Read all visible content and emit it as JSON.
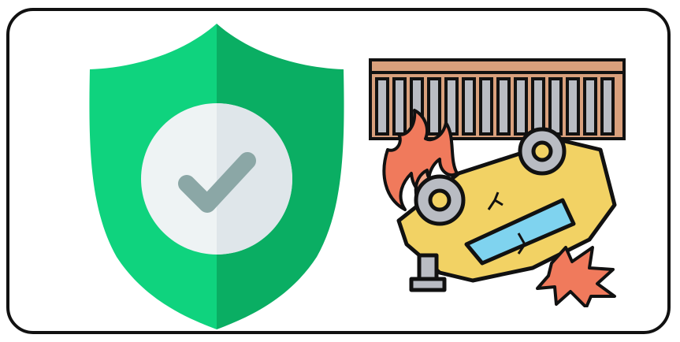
{
  "icons": [
    {
      "name": "shield-check-icon",
      "meaning": "protection",
      "colors": {
        "left": "#0fd37e",
        "right": "#0aae63",
        "circle": "#eef3f4",
        "check": "#8ba7a6"
      }
    },
    {
      "name": "car-crash-bridge-icon",
      "meaning": "accident",
      "colors": {
        "railing": "#d9a07c",
        "car": "#f2d264",
        "windshield": "#7fd3ef",
        "fire": "#f07a5c",
        "wheel": "#b9bcc3",
        "outline": "#111111"
      }
    }
  ]
}
